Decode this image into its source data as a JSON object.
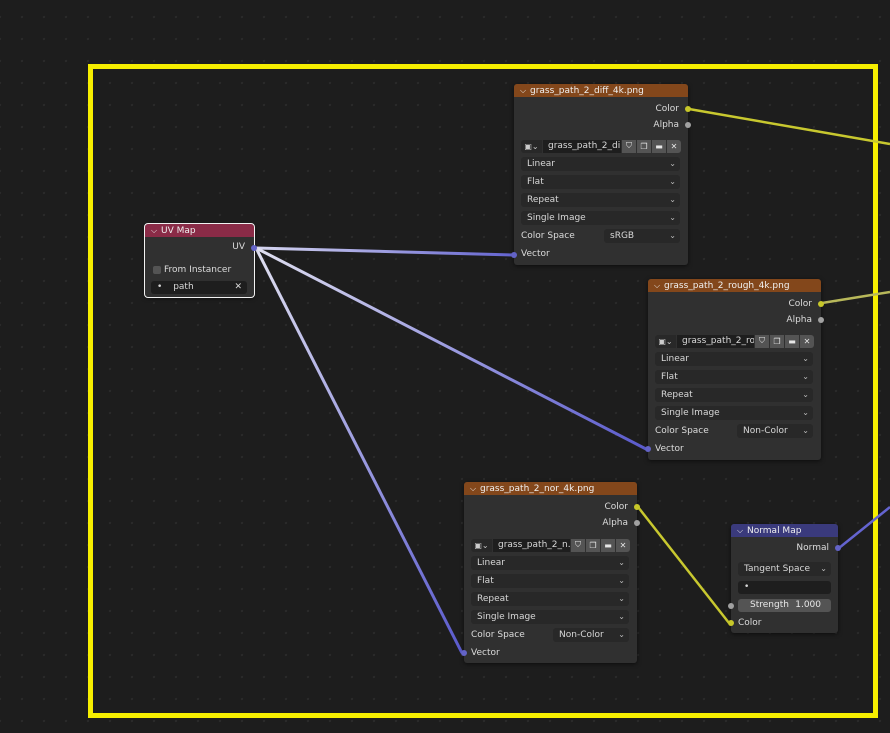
{
  "nodes": {
    "uv_map": {
      "title": "UV Map",
      "output": "UV",
      "from_instancer": "From Instancer",
      "uv_field": "path",
      "uv_bullet": "•",
      "clear": "✕"
    },
    "tex_diff": {
      "title": "grass_path_2_diff_4k.png",
      "outputs": [
        "Color",
        "Alpha"
      ],
      "image_name": "grass_path_2_di...",
      "interpolation": "Linear",
      "projection": "Flat",
      "extension": "Repeat",
      "source": "Single Image",
      "color_space_label": "Color Space",
      "color_space": "sRGB",
      "input": "Vector"
    },
    "tex_rough": {
      "title": "grass_path_2_rough_4k.png",
      "outputs": [
        "Color",
        "Alpha"
      ],
      "image_name": "grass_path_2_ro...",
      "interpolation": "Linear",
      "projection": "Flat",
      "extension": "Repeat",
      "source": "Single Image",
      "color_space_label": "Color Space",
      "color_space": "Non-Color",
      "input": "Vector"
    },
    "tex_nor": {
      "title": "grass_path_2_nor_4k.png",
      "outputs": [
        "Color",
        "Alpha"
      ],
      "image_name": "grass_path_2_n...",
      "interpolation": "Linear",
      "projection": "Flat",
      "extension": "Repeat",
      "source": "Single Image",
      "color_space_label": "Color Space",
      "color_space": "Non-Color",
      "input": "Vector"
    },
    "normal_map": {
      "title": "Normal Map",
      "output": "Normal",
      "space": "Tangent Space",
      "uv_bullet": "•",
      "strength_label": "Strength",
      "strength_value": "1.000",
      "input_color": "Color"
    }
  },
  "colors": {
    "frame": "#f6ee00",
    "texture_header": "#83471b",
    "uv_header": "#8a2b47",
    "vector_header": "#3a3a7c",
    "color_socket": "#c7c729",
    "vector_socket": "#6363c7",
    "float_socket": "#a1a1a1"
  },
  "icons": {
    "collapse": "chevron-down-icon",
    "image": "image-icon",
    "fake_user": "shield-icon",
    "duplicate": "duplicate-icon",
    "open": "folder-icon",
    "unlink": "close-icon"
  }
}
